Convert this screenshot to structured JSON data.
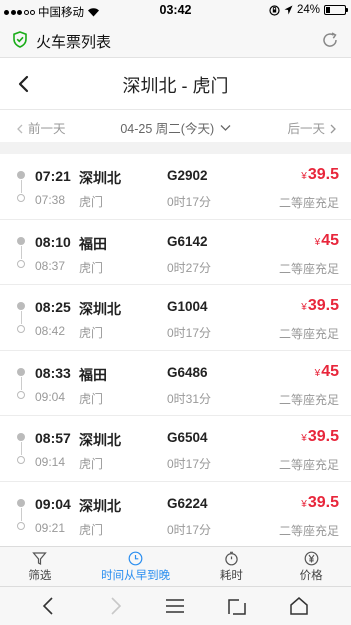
{
  "status_bar": {
    "carrier": "中国移动",
    "time": "03:42",
    "battery": "24%",
    "battery_level": 0.24
  },
  "app_bar": {
    "title": "火车票列表",
    "shield_icon": "shield-check-icon",
    "reload_icon": "reload-icon"
  },
  "nav": {
    "back_icon": "chevron-left-icon",
    "route": "深圳北 - 虎门"
  },
  "date_bar": {
    "prev": "前一天",
    "current": "04-25 周二(今天)",
    "next": "后一天"
  },
  "trains": [
    {
      "dep_time": "07:21",
      "arr_time": "07:38",
      "from": "深圳北",
      "to": "虎门",
      "train_no": "G2902",
      "duration": "0时17分",
      "currency": "¥",
      "price": "39.5",
      "seat": "二等座充足"
    },
    {
      "dep_time": "08:10",
      "arr_time": "08:37",
      "from": "福田",
      "to": "虎门",
      "train_no": "G6142",
      "duration": "0时27分",
      "currency": "¥",
      "price": "45",
      "seat": "二等座充足"
    },
    {
      "dep_time": "08:25",
      "arr_time": "08:42",
      "from": "深圳北",
      "to": "虎门",
      "train_no": "G1004",
      "duration": "0时17分",
      "currency": "¥",
      "price": "39.5",
      "seat": "二等座充足"
    },
    {
      "dep_time": "08:33",
      "arr_time": "09:04",
      "from": "福田",
      "to": "虎门",
      "train_no": "G6486",
      "duration": "0时31分",
      "currency": "¥",
      "price": "45",
      "seat": "二等座充足"
    },
    {
      "dep_time": "08:57",
      "arr_time": "09:14",
      "from": "深圳北",
      "to": "虎门",
      "train_no": "G6504",
      "duration": "0时17分",
      "currency": "¥",
      "price": "39.5",
      "seat": "二等座充足"
    },
    {
      "dep_time": "09:04",
      "arr_time": "09:21",
      "from": "深圳北",
      "to": "虎门",
      "train_no": "G6224",
      "duration": "0时17分",
      "currency": "¥",
      "price": "39.5",
      "seat": "二等座充足"
    }
  ],
  "filter_bar": {
    "filter": "筛选",
    "time_sort": "时间从早到晚",
    "duration": "耗时",
    "price": "价格"
  },
  "colors": {
    "accent": "#2a8ef0",
    "price": "#e8263b",
    "shield": "#1aad19"
  }
}
